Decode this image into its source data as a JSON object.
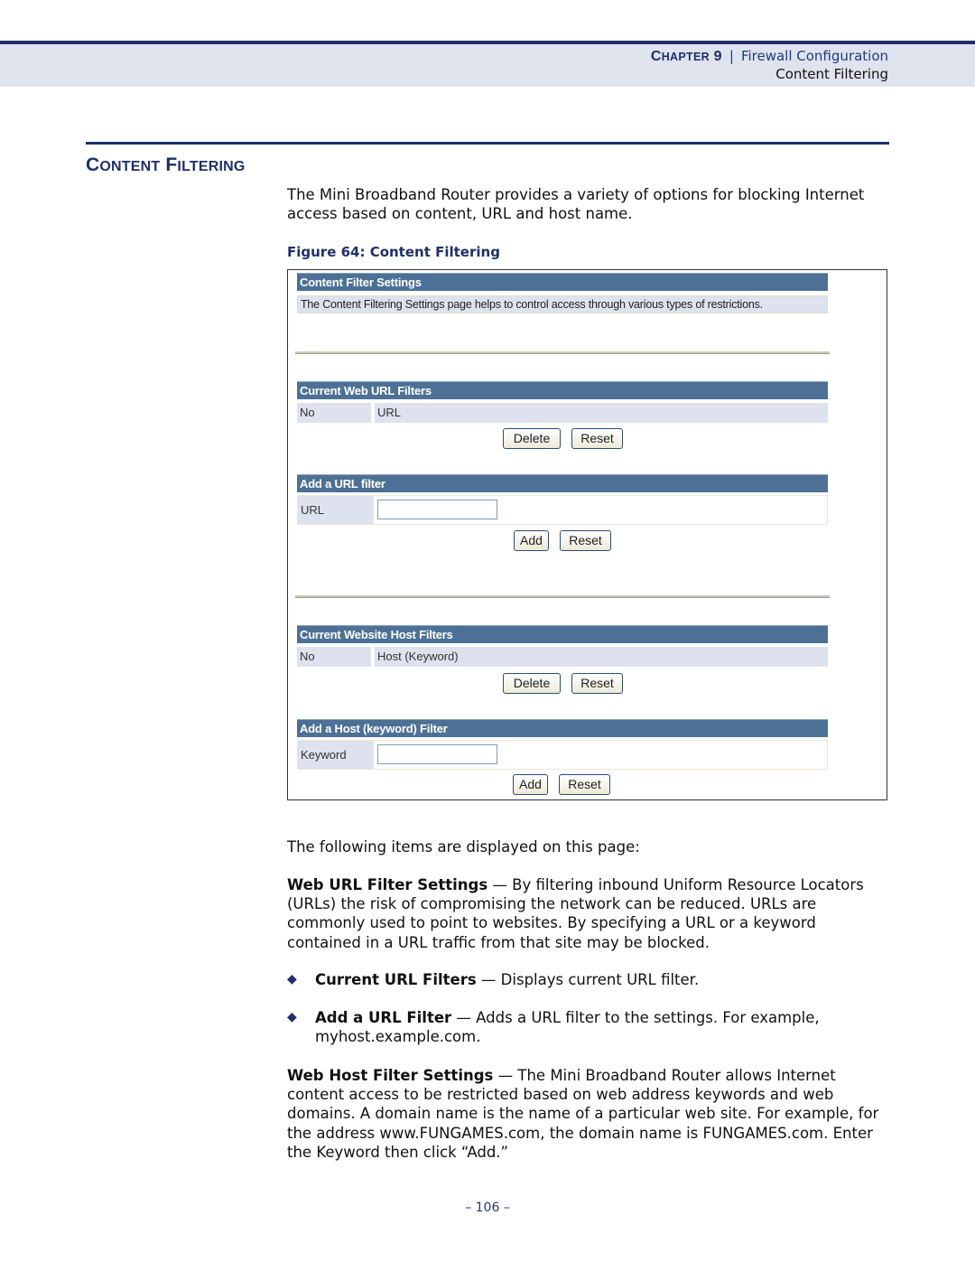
{
  "header": {
    "chapter_label": "Chapter 9",
    "chapter_title": "Firewall Configuration",
    "section": "Content Filtering"
  },
  "section_title": "Content Filtering",
  "intro": "The Mini Broadband Router provides a variety of options for blocking Internet access based on content, URL and host name.",
  "figure_caption": "Figure 64:  Content Filtering",
  "figure": {
    "settings_title": "Content Filter Settings",
    "settings_desc": "The Content Filtering Settings page helps to control access through various types of restrictions.",
    "url_filters": {
      "title": "Current Web URL Filters",
      "columns": [
        "No",
        "URL"
      ],
      "delete_label": "Delete",
      "reset_label": "Reset"
    },
    "add_url": {
      "title": "Add a URL filter",
      "field_label": "URL",
      "field_value": "",
      "add_label": "Add",
      "reset_label": "Reset"
    },
    "host_filters": {
      "title": "Current Website Host Filters",
      "columns": [
        "No",
        "Host (Keyword)"
      ],
      "delete_label": "Delete",
      "reset_label": "Reset"
    },
    "add_host": {
      "title": "Add a Host (keyword) Filter",
      "field_label": "Keyword",
      "field_value": "",
      "add_label": "Add",
      "reset_label": "Reset"
    }
  },
  "items_intro": "The following items are displayed on this page:",
  "web_url": {
    "term": "Web URL Filter Settings",
    "text": " — By filtering inbound Uniform Resource Locators (URLs) the risk of compromising the network can be reduced. URLs are commonly used to point to websites. By specifying a URL or a keyword contained in a URL traffic from that site may be blocked."
  },
  "bullets": [
    {
      "term": "Current URL Filters",
      "text": " — Displays current URL filter."
    },
    {
      "term": "Add a URL Filter",
      "text": " — Adds a URL filter to the settings. For example, myhost.example.com."
    }
  ],
  "web_host": {
    "term": "Web Host Filter Settings",
    "text": " — The Mini Broadband Router allows Internet content access to be restricted based on web address keywords and web domains. A domain name is the name of a particular web site. For example, for the address www.FUNGAMES.com, the domain name is FUNGAMES.com. Enter the Keyword then click “Add.”"
  },
  "page_number": "–  106  –",
  "bullet_icon": "diamond-icon"
}
